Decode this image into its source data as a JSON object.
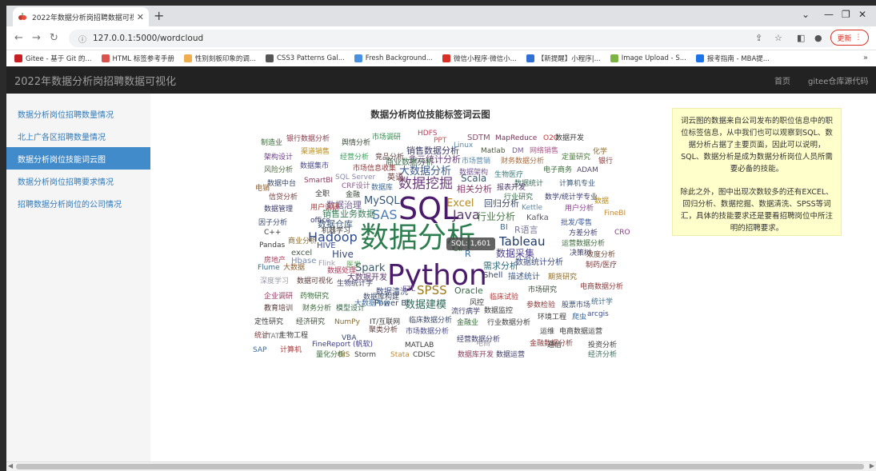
{
  "browser": {
    "tab_title": "2022年数据分析岗招聘数据可视化",
    "tab_close": "✕",
    "new_tab": "+",
    "url": "127.0.0.1:5000/wordcloud",
    "update_label": "更新",
    "win_minimize": "⌄",
    "win_restore": "—",
    "win_max": "❐",
    "win_close": "✕"
  },
  "bookmarks": [
    {
      "label": "Gitee - 基于 Git 的...",
      "color": "#c71d23"
    },
    {
      "label": "HTML 标签参考手册",
      "color": "#d9534f"
    },
    {
      "label": "性别刻板印象的调...",
      "color": "#f0ad4e"
    },
    {
      "label": "CSS3 Patterns Gal...",
      "color": "#555555"
    },
    {
      "label": "Fresh Background...",
      "color": "#4a90e2"
    },
    {
      "label": "微信小程序·微信小...",
      "color": "#d93025"
    },
    {
      "label": "【新提醒】小程序|...",
      "color": "#2f6fd6"
    },
    {
      "label": "Image Upload - S...",
      "color": "#7cb342"
    },
    {
      "label": "报考指南 - MBA提...",
      "color": "#1a73e8"
    }
  ],
  "bookmarks_more": "»",
  "header": {
    "brand": "2022年数据分析岗招聘数据可视化",
    "nav_home": "首页",
    "nav_repo": "gitee仓库源代码"
  },
  "sidebar": {
    "items": [
      {
        "label": "数据分析岗位招聘数量情况",
        "active": false
      },
      {
        "label": "北上广各区招聘数量情况",
        "active": false
      },
      {
        "label": "数据分析岗位技能词云图",
        "active": true
      },
      {
        "label": "数据分析岗位招聘要求情况",
        "active": false
      },
      {
        "label": "招聘数据分析岗位的公司情况",
        "active": false
      }
    ]
  },
  "main": {
    "cloud_title": "数据分析岗位技能标签词云图",
    "tooltip": "SQL: 1,601",
    "note_p1": "词云图的数据来自公司发布的职位信息中的职位标签信息，从中我们也可以观察到SQL、数据分析占据了主要页面，因此可以说明，SQL、数据分析是成为数据分析岗位人员所需要必备的技能。",
    "note_p2": "除此之外，图中出现次数较多的还有EXCEL、回归分析、数据挖掘、数据清洗、SPSS等词汇，具体的技能要求还是要看招聘岗位中所注明的招聘要求。"
  },
  "wordcloud": [
    {
      "t": "数据分析",
      "c": "#2e7d4f"
    },
    {
      "t": "SQL",
      "c": "#4a1a6b"
    },
    {
      "t": "Python",
      "c": "#4a1a6b"
    },
    {
      "t": "数据挖掘",
      "c": "#6a3a7a"
    },
    {
      "t": "SAS",
      "c": "#4b7bb5"
    },
    {
      "t": "Java",
      "c": "#5a3a6a"
    },
    {
      "t": "Hadoop",
      "c": "#2e4a8a"
    },
    {
      "t": "Tableau",
      "c": "#1f3a6a"
    },
    {
      "t": "Excel",
      "c": "#b58a1a"
    },
    {
      "t": "SPSS",
      "c": "#9a7a1a"
    },
    {
      "t": "大数据分析",
      "c": "#3a5a8a"
    },
    {
      "t": "数据建模",
      "c": "#2e6a5a"
    },
    {
      "t": "数据采集",
      "c": "#4a3a8a"
    },
    {
      "t": "Hive",
      "c": "#3a4a7a"
    },
    {
      "t": "Spark",
      "c": "#3a5a6a"
    },
    {
      "t": "MySQL",
      "c": "#3a5a7a"
    },
    {
      "t": "Scala",
      "c": "#3a5a6a"
    },
    {
      "t": "行业分析",
      "c": "#4a7a4a"
    },
    {
      "t": "回归分析",
      "c": "#3a4a6a"
    },
    {
      "t": "数据仓库",
      "c": "#3a5a7a"
    },
    {
      "t": "Oracle",
      "c": "#3a6a4a"
    },
    {
      "t": "多元统计分析",
      "c": "#6a3a7a"
    },
    {
      "t": "相关分析",
      "c": "#8a3a6a"
    },
    {
      "t": "需求分析",
      "c": "#2e6a7a"
    },
    {
      "t": "数据清洗",
      "c": "#3a4a7a"
    },
    {
      "t": "数据统计分析",
      "c": "#3a4a7a"
    },
    {
      "t": "商业数据分析",
      "c": "#3a6a4a"
    },
    {
      "t": "描述统计",
      "c": "#3a5a8a"
    },
    {
      "t": "大数据开发",
      "c": "#5a3a6a"
    },
    {
      "t": "数据治理",
      "c": "#6a5a8a"
    },
    {
      "t": "Power BI",
      "c": "#3a4a6a"
    },
    {
      "t": "BI",
      "c": "#4a6a8a"
    },
    {
      "t": "R语言",
      "c": "#7a7a9a"
    },
    {
      "t": "R",
      "c": "#3a6a9a"
    },
    {
      "t": "Shell",
      "c": "#3a4a6a"
    },
    {
      "t": "HIVE",
      "c": "#3a4a8a"
    },
    {
      "t": "excel",
      "c": "#4a5a4a"
    },
    {
      "t": "Hbase",
      "c": "#7a8aaa"
    },
    {
      "t": "Flink",
      "c": "#9a9aaa"
    },
    {
      "t": "Kafka",
      "c": "#5a5a6a"
    },
    {
      "t": "销售数据分析",
      "c": "#3a3a6a"
    },
    {
      "t": "销售业务数据",
      "c": "#3a7a5a"
    },
    {
      "t": "市场调研",
      "c": "#2e8a4a"
    },
    {
      "t": "SDTM",
      "c": "#8a4a6a"
    },
    {
      "t": "HDFS",
      "c": "#c03a5a"
    },
    {
      "t": "PPT",
      "c": "#c05a5a"
    },
    {
      "t": "Linux",
      "c": "#5a8aaa"
    },
    {
      "t": "Matlab",
      "c": "#4a5a3a"
    },
    {
      "t": "DM",
      "c": "#7a5a9a"
    },
    {
      "t": "MapReduce",
      "c": "#7a2e5a"
    },
    {
      "t": "O2O",
      "c": "#c03a3a"
    },
    {
      "t": "数据开发",
      "c": "#3a3a3a"
    },
    {
      "t": "网络销售",
      "c": "#aa5a8a"
    },
    {
      "t": "化学",
      "c": "#8a6a2a"
    },
    {
      "t": "制造业",
      "c": "#3a6a3a"
    },
    {
      "t": "银行数据分析",
      "c": "#8a3a4a"
    },
    {
      "t": "舆情分析",
      "c": "#3a4a3a"
    },
    {
      "t": "架构设计",
      "c": "#6a3a8a"
    },
    {
      "t": "渠道销售",
      "c": "#b58a1a"
    },
    {
      "t": "经营分析",
      "c": "#3a9a5a"
    },
    {
      "t": "竞品分析",
      "c": "#5a3a3a"
    },
    {
      "t": "市场营销",
      "c": "#5a8aaa"
    },
    {
      "t": "财务数据分析",
      "c": "#aa6a3a"
    },
    {
      "t": "定量研究",
      "c": "#4a7a3a"
    },
    {
      "t": "银行",
      "c": "#8a3a3a"
    },
    {
      "t": "风险分析",
      "c": "#4a6a3a"
    },
    {
      "t": "数据集市",
      "c": "#4a4a8a"
    },
    {
      "t": "市场信息收集",
      "c": "#8a3a3a"
    },
    {
      "t": "数据架构",
      "c": "#7a5a9a"
    },
    {
      "t": "生物医疗",
      "c": "#3a7a7a"
    },
    {
      "t": "电子商务",
      "c": "#3a6a3a"
    },
    {
      "t": "ADAM",
      "c": "#5a4a6a"
    },
    {
      "t": "SQL Server",
      "c": "#8a8aaa"
    },
    {
      "t": "英语",
      "c": "#6a3a3a"
    },
    {
      "t": "SmartBI",
      "c": "#8a3a5a"
    },
    {
      "t": "数据中台",
      "c": "#3a4a6a"
    },
    {
      "t": "数据统计",
      "c": "#3a6a5a"
    },
    {
      "t": "计算机专业",
      "c": "#3a5a7a"
    },
    {
      "t": "电销",
      "c": "#8a5a2a"
    },
    {
      "t": "CRF设计",
      "c": "#8a5a8a"
    },
    {
      "t": "数据库",
      "c": "#3a6a9a"
    },
    {
      "t": "报表开发",
      "c": "#4a3a6a"
    },
    {
      "t": "信贷分析",
      "c": "#7a3a3a"
    },
    {
      "t": "全职",
      "c": "#3a3a3a"
    },
    {
      "t": "金融",
      "c": "#3a4a3a"
    },
    {
      "t": "行业研究",
      "c": "#3a6a4a"
    },
    {
      "t": "数学/统计学专业",
      "c": "#3a3a6a"
    },
    {
      "t": "数据",
      "c": "#b58a1a"
    },
    {
      "t": "数据管理",
      "c": "#3a3a6a"
    },
    {
      "t": "用户调研",
      "c": "#aa3a3a"
    },
    {
      "t": "Kettle",
      "c": "#5a8aaa"
    },
    {
      "t": "用户分析",
      "c": "#8a3a8a"
    },
    {
      "t": "FineBI",
      "c": "#c08a3a"
    },
    {
      "t": "因子分析",
      "c": "#3a4a6a"
    },
    {
      "t": "office",
      "c": "#3a3a6a"
    },
    {
      "t": "批发/零售",
      "c": "#3a5a9a"
    },
    {
      "t": "机器学习",
      "c": "#3a3a3a"
    },
    {
      "t": "C++",
      "c": "#3a3a3a"
    },
    {
      "t": "CRO",
      "c": "#8a3a8a"
    },
    {
      "t": "方差分析",
      "c": "#3a3a6a"
    },
    {
      "t": "商业分析",
      "c": "#8a6a2a"
    },
    {
      "t": "运营数据分析",
      "c": "#3a6a3a"
    },
    {
      "t": "Pandas",
      "c": "#3a3a3a"
    },
    {
      "t": "C#",
      "c": "#3a9a5a"
    },
    {
      "t": "决策树",
      "c": "#3a3a6a"
    },
    {
      "t": "效度分析",
      "c": "#6a4a3a"
    },
    {
      "t": "房地产",
      "c": "#aa3a5a"
    },
    {
      "t": "医学",
      "c": "#5a9a5a"
    },
    {
      "t": "制药/医疗",
      "c": "#7a3a3a"
    },
    {
      "t": "Flume",
      "c": "#3a6a8a"
    },
    {
      "t": "大数据",
      "c": "#8a5a2a"
    },
    {
      "t": "数据处理",
      "c": "#aa3a5a"
    },
    {
      "t": "期货研究",
      "c": "#8a6a2a"
    },
    {
      "t": "深度学习",
      "c": "#9a9aaa"
    },
    {
      "t": "数据可视化",
      "c": "#5a3a3a"
    },
    {
      "t": "生物统计学",
      "c": "#3a3a6a"
    },
    {
      "t": "ETL",
      "c": "#7a5a9a"
    },
    {
      "t": "市场研究",
      "c": "#3a4a3a"
    },
    {
      "t": "电商数据分析",
      "c": "#8a3a3a"
    },
    {
      "t": "企业调研",
      "c": "#8a3a5a"
    },
    {
      "t": "药物研究",
      "c": "#3a6a3a"
    },
    {
      "t": "数据库构建",
      "c": "#3a4a6a"
    },
    {
      "t": "临床试验",
      "c": "#aa3a3a"
    },
    {
      "t": "统计学",
      "c": "#3a6a8a"
    },
    {
      "t": "大数据平台",
      "c": "#3a6a9a"
    },
    {
      "t": "风控",
      "c": "#3a3a3a"
    },
    {
      "t": "参数检验",
      "c": "#8a3a3a"
    },
    {
      "t": "股票市场",
      "c": "#3a4a6a"
    },
    {
      "t": "教育培训",
      "c": "#5a3a3a"
    },
    {
      "t": "财务分析",
      "c": "#3a6a3a"
    },
    {
      "t": "模型设计",
      "c": "#3a6a4a"
    },
    {
      "t": "流行病学",
      "c": "#3a3a6a"
    },
    {
      "t": "数据监控",
      "c": "#3a3a3a"
    },
    {
      "t": "环境工程",
      "c": "#3a3a3a"
    },
    {
      "t": "爬虫",
      "c": "#3a6a9a"
    },
    {
      "t": "arcgis",
      "c": "#3a4a8a"
    },
    {
      "t": "定性研究",
      "c": "#3a3a3a"
    },
    {
      "t": "经济研究",
      "c": "#3a4a3a"
    },
    {
      "t": "NumPy",
      "c": "#8a6a2a"
    },
    {
      "t": "IT/互联网",
      "c": "#3a3a3a"
    },
    {
      "t": "临床数据分析",
      "c": "#3a4a6a"
    },
    {
      "t": "金融业",
      "c": "#3a6a3a"
    },
    {
      "t": "行业数据分析",
      "c": "#3a3a3a"
    },
    {
      "t": "聚类分析",
      "c": "#5a3a3a"
    },
    {
      "t": "市场数据分析",
      "c": "#4a4a8a"
    },
    {
      "t": "运维",
      "c": "#3a3a3a"
    },
    {
      "t": "电商数据运营",
      "c": "#3a3a3a"
    },
    {
      "t": "统计",
      "c": "#7a3a3a"
    },
    {
      "t": "生物工程",
      "c": "#3a3a3a"
    },
    {
      "t": "VBA",
      "c": "#3a4a6a"
    },
    {
      "t": "FineReport (帆软)",
      "c": "#3a3a8a"
    },
    {
      "t": "MATLAB",
      "c": "#3a3a3a"
    },
    {
      "t": "经营数据分析",
      "c": "#3a3a6a"
    },
    {
      "t": "电商",
      "c": "#9a9aaa"
    },
    {
      "t": "金融数据分析",
      "c": "#8a3a3a"
    },
    {
      "t": "通信",
      "c": "#3a3a3a"
    },
    {
      "t": "投资分析",
      "c": "#3a3a3a"
    },
    {
      "t": "SAP",
      "c": "#3a6a9a"
    },
    {
      "t": "计算机",
      "c": "#aa3a3a"
    },
    {
      "t": "量化分析",
      "c": "#3a6a3a"
    },
    {
      "t": "GIS",
      "c": "#8a6a2a"
    },
    {
      "t": "Storm",
      "c": "#3a3a3a"
    },
    {
      "t": "Stata",
      "c": "#c08a3a"
    },
    {
      "t": "CDISC",
      "c": "#3a3a3a"
    },
    {
      "t": "数据库开发",
      "c": "#8a3a5a"
    },
    {
      "t": "数据运营",
      "c": "#3a3a6a"
    },
    {
      "t": "经济分析",
      "c": "#3a6a5a"
    },
    {
      "t": "STATA",
      "c": "#7a7a7a"
    }
  ]
}
